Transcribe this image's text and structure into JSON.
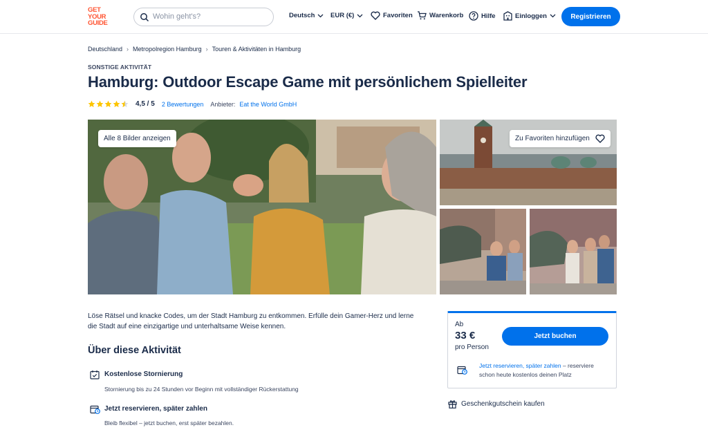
{
  "header": {
    "logo_lines": [
      "GET",
      "YOUR",
      "GUIDE"
    ],
    "search_placeholder": "Wohin geht's?",
    "language": "Deutsch",
    "currency": "EUR (€)",
    "favorites": "Favoriten",
    "cart": "Warenkorb",
    "help": "Hilfe",
    "login": "Einloggen",
    "register": "Registrieren"
  },
  "breadcrumb": [
    "Deutschland",
    "Metropolregion Hamburg",
    "Touren & Aktivitäten in Hamburg"
  ],
  "category": "SONSTIGE AKTIVITÄT",
  "title": "Hamburg: Outdoor Escape Game mit persönlichem Spielleiter",
  "rating": {
    "value": 4.5,
    "display": "4,5 / 5",
    "reviews": "2 Bewertungen",
    "provider_label": "Anbieter:",
    "provider": "Eat the World GmbH"
  },
  "gallery": {
    "show_all": "Alle 8 Bilder anzeigen",
    "add_favorite": "Zu Favoriten hinzufügen"
  },
  "description": "Löse Rätsel und knacke Codes, um der Stadt Hamburg zu entkommen. Erfülle dein Gamer-Herz und lerne die Stadt auf eine einzigartige und unterhaltsame Weise kennen.",
  "about": {
    "title": "Über diese Aktivität",
    "features": [
      {
        "icon": "calendar-check-icon",
        "title": "Kostenlose Stornierung",
        "subtitle": "Stornierung bis zu 24 Stunden vor Beginn mit vollständiger Rückerstattung"
      },
      {
        "icon": "calendar-clock-icon",
        "title": "Jetzt reservieren, später zahlen",
        "subtitle": "Bleib flexibel – jetzt buchen, erst später bezahlen."
      }
    ]
  },
  "booking": {
    "from": "Ab",
    "price": "33 €",
    "per_person": "pro Person",
    "book_button": "Jetzt buchen",
    "reserve_link": "Jetzt reservieren, später zahlen",
    "reserve_text": " – reserviere schon heute kostenlos deinen Platz",
    "gift": "Geschenkgutschein kaufen"
  },
  "colors": {
    "brand": "#ff5533",
    "primary": "#0071eb",
    "text": "#1a2b49",
    "star": "#fdc500"
  }
}
